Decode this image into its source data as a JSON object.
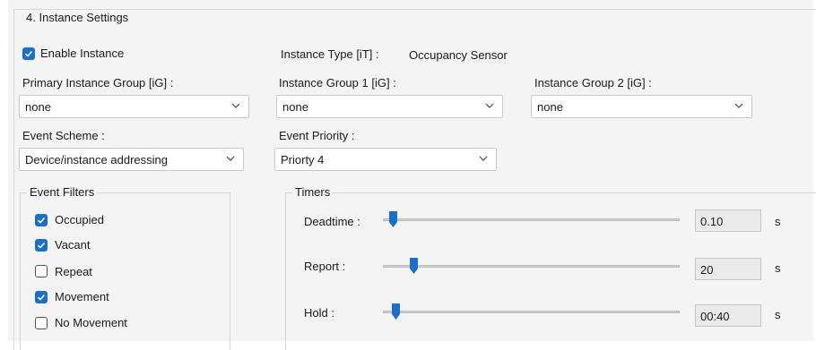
{
  "section": {
    "title": "4. Instance Settings"
  },
  "enable_instance": {
    "label": "Enable Instance",
    "checked": true
  },
  "instance_type": {
    "label": "Instance Type [iT] :",
    "value": "Occupancy Sensor"
  },
  "primary_group": {
    "label": "Primary Instance Group [iG] :",
    "value": "none"
  },
  "group1": {
    "label": "Instance Group 1 [iG] :",
    "value": "none"
  },
  "group2": {
    "label": "Instance Group 2 [iG] :",
    "value": "none"
  },
  "event_scheme": {
    "label": "Event Scheme :",
    "value": "Device/instance addressing"
  },
  "event_priority": {
    "label": "Event Priority :",
    "value": "Priorty 4"
  },
  "event_filters": {
    "title": "Event Filters",
    "items": [
      {
        "label": "Occupied",
        "checked": true
      },
      {
        "label": "Vacant",
        "checked": true
      },
      {
        "label": "Repeat",
        "checked": false
      },
      {
        "label": "Movement",
        "checked": true
      },
      {
        "label": "No Movement",
        "checked": false
      }
    ]
  },
  "timers": {
    "title": "Timers",
    "unit": "s",
    "rows": [
      {
        "label": "Deadtime :",
        "value": "0.10",
        "slider_level": 0.02
      },
      {
        "label": "Report :",
        "value": "20",
        "slider_level": 0.09
      },
      {
        "label": "Hold :",
        "value": "00:40",
        "slider_level": 0.03
      }
    ]
  },
  "colors": {
    "accent": "#1a6fc9",
    "panel": "#f4f4f4"
  }
}
